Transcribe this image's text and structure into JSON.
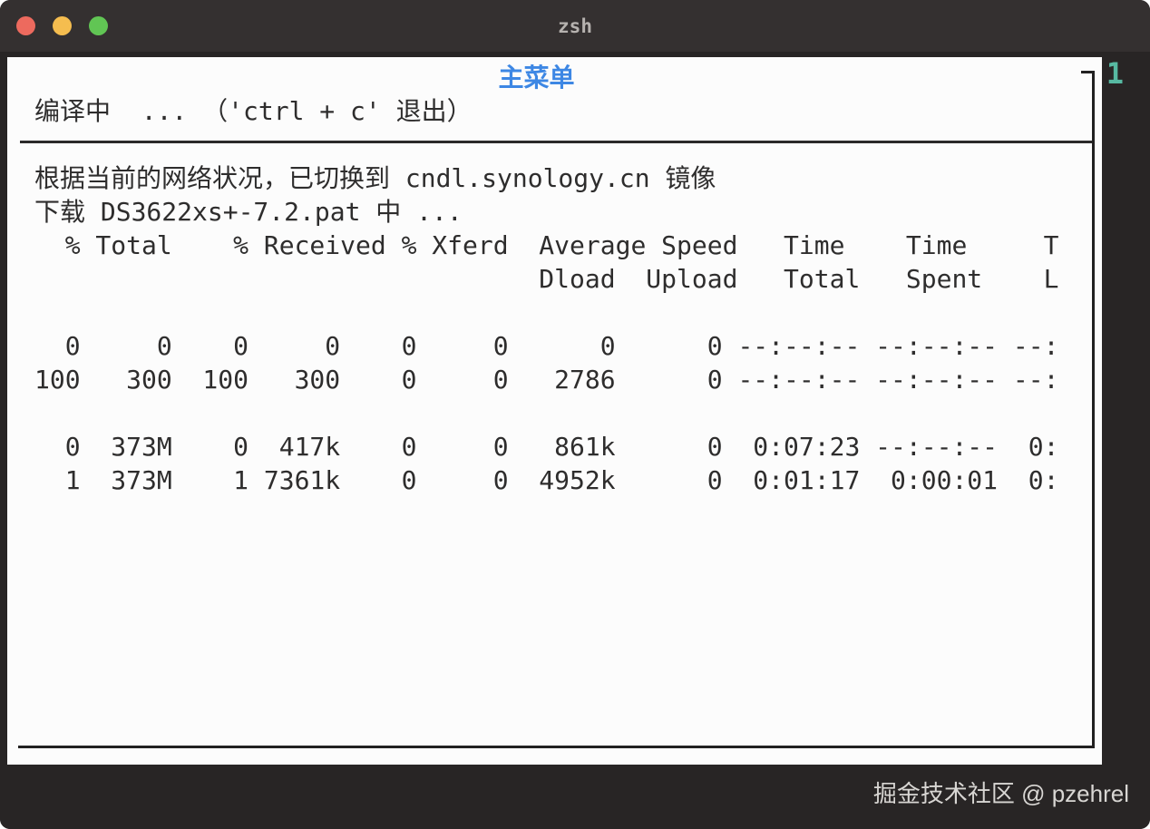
{
  "window": {
    "title": "zsh",
    "traffic_lights": [
      "close",
      "minimize",
      "zoom"
    ]
  },
  "terminal": {
    "pane_number": "1",
    "menu_title": "主菜单",
    "status_line": "编译中  ... （'ctrl + c' 退出）",
    "mirror_line": "根据当前的网络状况，已切换到 cndl.synology.cn 镜像",
    "download_line": "下载 DS3622xs+-7.2.pat 中 ...",
    "curl_table": {
      "header1": "  % Total    % Received % Xferd  Average Speed   Time    Time     T",
      "header2": "                                 Dload  Upload   Total   Spent    L",
      "rows": [
        "  0     0    0     0    0     0      0      0 --:--:-- --:--:-- --:",
        "100   300  100   300    0     0   2786      0 --:--:-- --:--:-- --:",
        "  0  373M    0  417k    0     0   861k      0  0:07:23 --:--:--  0:",
        "  1  373M    1 7361k    0     0  4952k      0  0:01:17  0:00:01  0:"
      ]
    }
  },
  "watermark": {
    "text": "掘金技术社区 @ pzehrel"
  },
  "colors": {
    "menu_title_blue": "#3d87e4",
    "pane_number_teal": "#57b9a2",
    "panel_background": "#fcfcfc",
    "terminal_background": "#282525",
    "titlebar_background": "#343030",
    "traffic_red": "#ed6a5e",
    "traffic_yellow": "#f5bd4f",
    "traffic_green": "#61c554"
  }
}
